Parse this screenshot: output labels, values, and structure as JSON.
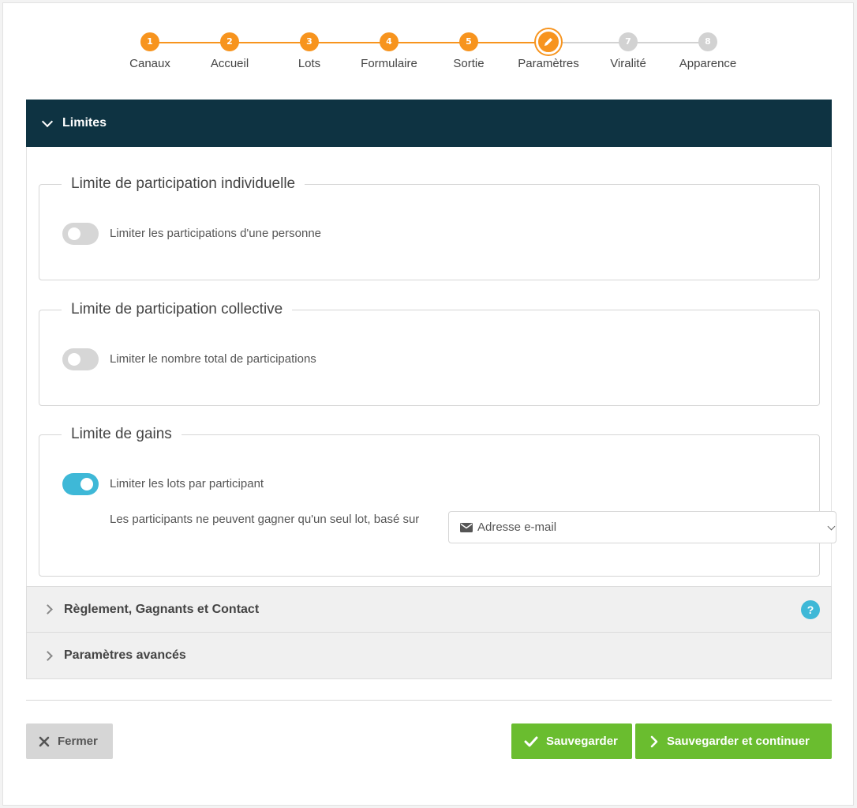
{
  "stepper": {
    "steps": [
      {
        "num": "1",
        "label": "Canaux",
        "state": "done"
      },
      {
        "num": "2",
        "label": "Accueil",
        "state": "done"
      },
      {
        "num": "3",
        "label": "Lots",
        "state": "done"
      },
      {
        "num": "4",
        "label": "Formulaire",
        "state": "done"
      },
      {
        "num": "5",
        "label": "Sortie",
        "state": "done"
      },
      {
        "num": "",
        "label": "Paramètres",
        "state": "current",
        "icon": "pencil-icon"
      },
      {
        "num": "7",
        "label": "Viralité",
        "state": "todo"
      },
      {
        "num": "8",
        "label": "Apparence",
        "state": "todo"
      }
    ],
    "colors": {
      "done": "#f7941e",
      "todo": "#d2d2d2"
    }
  },
  "limits": {
    "title": "Limites",
    "individual": {
      "legend": "Limite de participation individuelle",
      "toggle_label": "Limiter les participations d'une personne",
      "enabled": false
    },
    "collective": {
      "legend": "Limite de participation collective",
      "toggle_label": "Limiter le nombre total de participations",
      "enabled": false
    },
    "gains": {
      "legend": "Limite de gains",
      "toggle_label": "Limiter les lots par participant",
      "enabled": true,
      "description": "Les participants ne peuvent gagner qu'un seul lot, basé sur",
      "select_value": "Adresse e-mail",
      "select_icon": "envelope-icon"
    }
  },
  "sections": {
    "rules": {
      "label": "Règlement, Gagnants et Contact",
      "help": "?"
    },
    "advanced": {
      "label": "Paramètres avancés"
    }
  },
  "buttons": {
    "close": "Fermer",
    "save": "Sauvegarder",
    "save_continue": "Sauvegarder et continuer"
  },
  "colors": {
    "header_bg": "#0e3342",
    "accent_orange": "#f7941e",
    "toggle_on": "#3eb8d7",
    "save_green": "#6abd2f"
  }
}
